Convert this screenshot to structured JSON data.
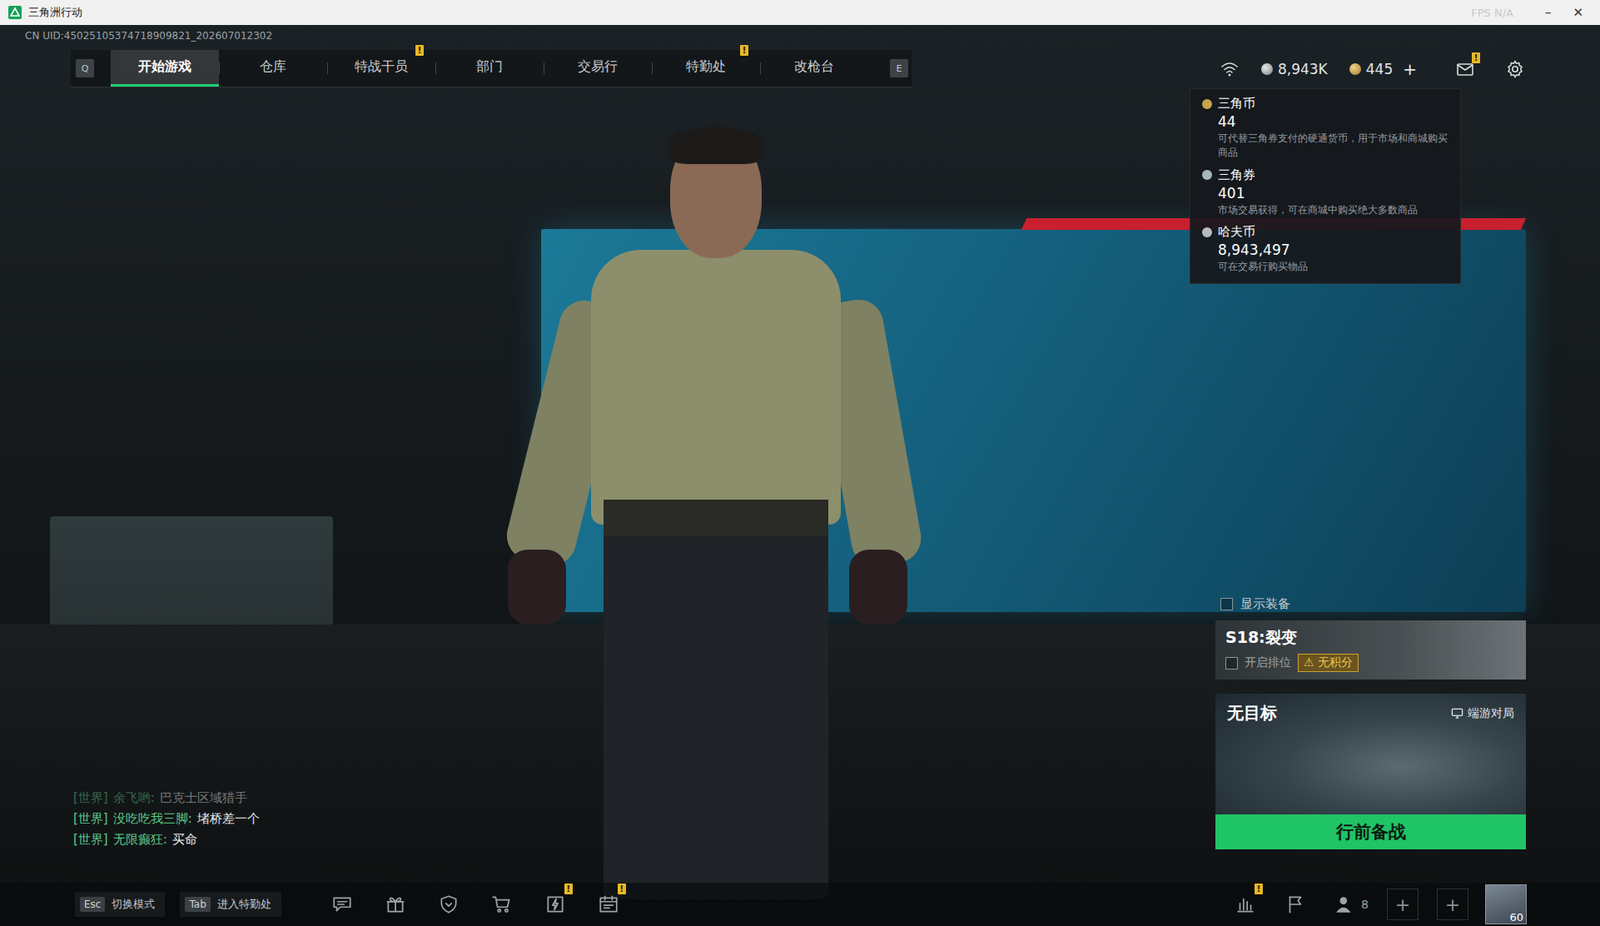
{
  "window": {
    "title": "三角洲行动",
    "overlay": "FPS N/A",
    "controls": [
      "–",
      "✕"
    ]
  },
  "uid": "CN UID:45025105374718909821_202607012302",
  "nav": {
    "prev_key": "Q",
    "next_key": "E",
    "tabs": [
      {
        "label": "开始游戏",
        "selected": true,
        "badge": ""
      },
      {
        "label": "仓库",
        "selected": false,
        "badge": ""
      },
      {
        "label": "特战干员",
        "selected": false,
        "badge": "!"
      },
      {
        "label": "部门",
        "selected": false,
        "badge": ""
      },
      {
        "label": "交易行",
        "selected": false,
        "badge": ""
      },
      {
        "label": "特勤处",
        "selected": false,
        "badge": "!"
      },
      {
        "label": "改枪台",
        "selected": false,
        "badge": ""
      }
    ]
  },
  "currency": {
    "haf": "8,943K",
    "coin": "445",
    "add": "+"
  },
  "mail": {
    "badge": "!"
  },
  "tooltip": {
    "items": [
      {
        "name": "三角币",
        "amount": "44",
        "desc": "可代替三角券支付的硬通货币，用于市场和商城购买商品",
        "color": "#c9a24a"
      },
      {
        "name": "三角券",
        "amount": "401",
        "desc": "市场交易获得，可在商城中购买绝大多数商品",
        "color": "#a9b6c0"
      },
      {
        "name": "哈夫币",
        "amount": "8,943,497",
        "desc": "可在交易行购买物品",
        "color": "#b8bcc0"
      }
    ]
  },
  "show_equipment": {
    "label": "显示装备",
    "checked": false
  },
  "season": {
    "title": "S18:裂变",
    "ranked": {
      "label": "开启排位",
      "checked": false
    },
    "warning_icon": "⚠",
    "warning": "无积分"
  },
  "map": {
    "title": "无目标",
    "platform": "端游对局"
  },
  "start_button": "行前备战",
  "chat": [
    {
      "channel": "[世界]",
      "name": "余飞哟:",
      "text": "巴克士区域猎手",
      "faded": true
    },
    {
      "channel": "[世界]",
      "name": "没吃吃我三脚:",
      "text": "堵桥差一个",
      "faded": false
    },
    {
      "channel": "[世界]",
      "name": "无限癫狂:",
      "text": "买命",
      "faded": false
    }
  ],
  "bottom": {
    "keys": [
      {
        "key": "Esc",
        "label": "切换模式"
      },
      {
        "key": "Tab",
        "label": "进入特勤处"
      }
    ],
    "tools": [
      {
        "kind": "chat",
        "badge": ""
      },
      {
        "kind": "gift",
        "badge": ""
      },
      {
        "kind": "shield",
        "badge": ""
      },
      {
        "kind": "cart",
        "badge": ""
      },
      {
        "kind": "pass",
        "badge": "!"
      },
      {
        "kind": "calendar",
        "badge": "!"
      }
    ],
    "right": [
      {
        "kind": "stats",
        "badge": "!"
      },
      {
        "kind": "flag",
        "badge": ""
      }
    ],
    "friends": "8",
    "slots": [
      "+",
      "+"
    ],
    "level": "60"
  }
}
